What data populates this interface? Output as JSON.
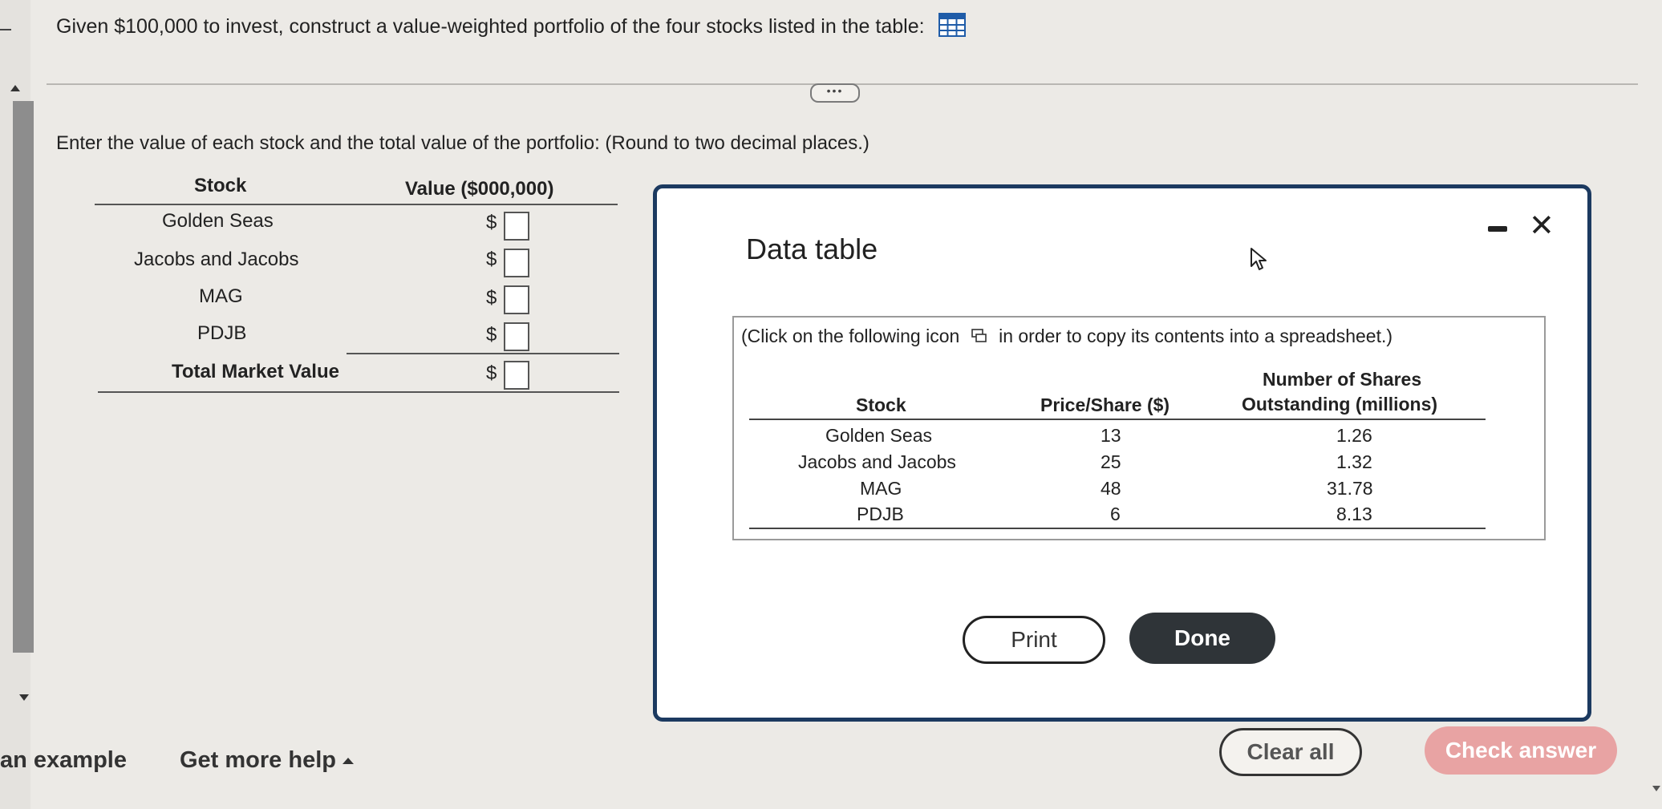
{
  "question": {
    "text": "Given $100,000 to invest, construct a value-weighted portfolio of the four stocks listed in the table:",
    "icon": "table-grid-icon"
  },
  "instruction": "Enter the value of each stock and the total value of the portfolio: (Round to two decimal places.)",
  "answer_table": {
    "header_stock": "Stock",
    "header_value": "Value ($000,000)",
    "currency": "$",
    "rows": [
      {
        "stock": "Golden Seas",
        "value": ""
      },
      {
        "stock": "Jacobs and Jacobs",
        "value": ""
      },
      {
        "stock": "MAG",
        "value": ""
      },
      {
        "stock": "PDJB",
        "value": ""
      }
    ],
    "total_label": "Total Market Value",
    "total_value": ""
  },
  "modal": {
    "title": "Data table",
    "note_before": "(Click on the following icon",
    "note_after": "in order to copy its contents into a spreadsheet.)",
    "headers": {
      "stock": "Stock",
      "price": "Price/Share ($)",
      "shares_line1": "Number of Shares",
      "shares_line2": "Outstanding (millions)"
    },
    "rows": [
      {
        "stock": "Golden Seas",
        "price": "13",
        "shares": "1.26"
      },
      {
        "stock": "Jacobs and Jacobs",
        "price": "25",
        "shares": "1.32"
      },
      {
        "stock": "MAG",
        "price": "48",
        "shares": "31.78"
      },
      {
        "stock": "PDJB",
        "price": "6",
        "shares": "8.13"
      }
    ],
    "print_label": "Print",
    "done_label": "Done"
  },
  "footer": {
    "example_label": "an example",
    "help_label": "Get more help",
    "clear_label": "Clear all",
    "check_label": "Check answer"
  },
  "colors": {
    "modal_border": "#1c3a60",
    "done_bg": "#2f3438",
    "check_bg": "#e8a3a3",
    "icon_blue": "#1f5ca8"
  }
}
